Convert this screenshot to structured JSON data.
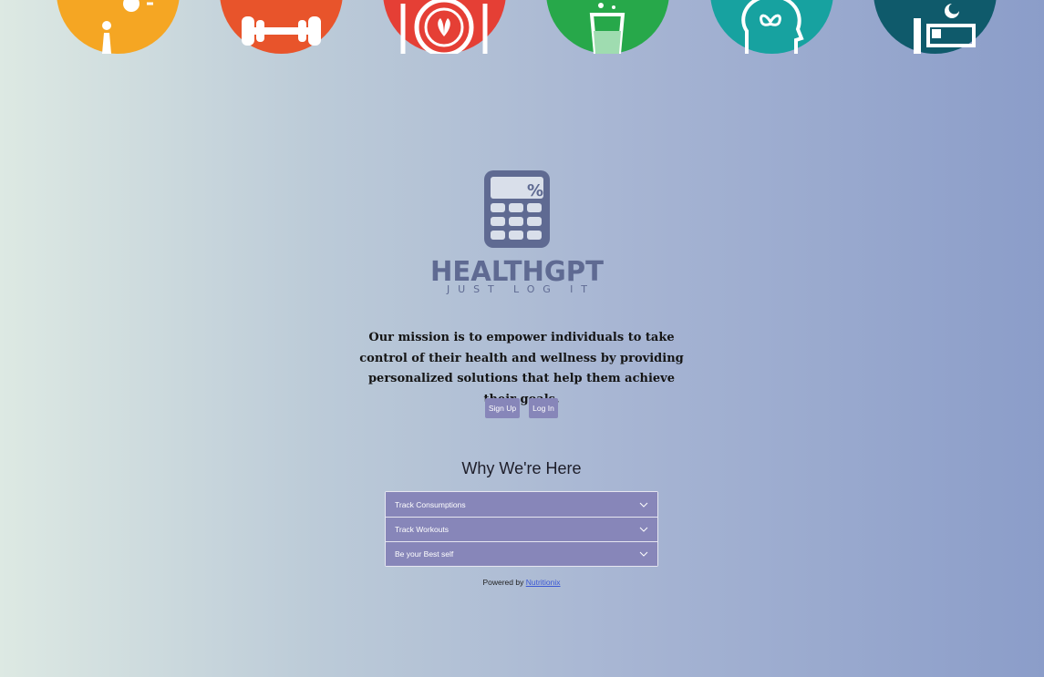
{
  "header_icons": [
    {
      "name": "sunny-walk-icon",
      "color": "#f5a623"
    },
    {
      "name": "dumbbell-icon",
      "color": "#e8542b"
    },
    {
      "name": "plate-leaf-icon",
      "color": "#e53f35"
    },
    {
      "name": "water-glass-icon",
      "color": "#27a84a"
    },
    {
      "name": "mind-butterfly-icon",
      "color": "#17a2a0"
    },
    {
      "name": "sleep-bed-icon",
      "color": "#0f5a6b"
    }
  ],
  "logo": {
    "brand": "HEALTHGPT",
    "tagline": "JUST LOG IT",
    "symbol": "%",
    "color": "#5f6a92",
    "icon": "calculator-icon"
  },
  "mission": "Our mission is to empower individuals to take control of their health and wellness by providing personalized solutions that help them achieve their goals.",
  "buttons": {
    "signup": "Sign Up",
    "login": "Log In"
  },
  "section": {
    "title": "Why We're Here"
  },
  "accordion": [
    {
      "label": "Track Consumptions"
    },
    {
      "label": "Track Workouts"
    },
    {
      "label": "Be your Best self"
    }
  ],
  "footer": {
    "prefix": "Powered by",
    "link": "Nutritionix"
  },
  "colors": {
    "accent": "#8786b9",
    "link": "#3a57d4"
  }
}
